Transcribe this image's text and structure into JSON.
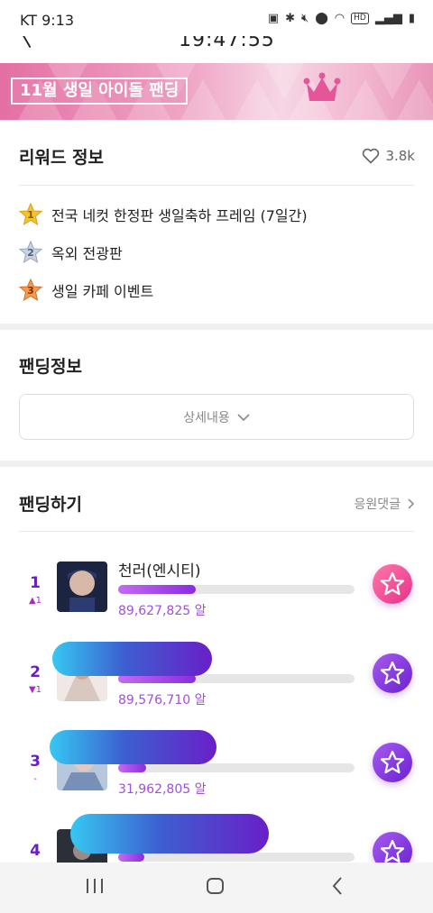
{
  "status_bar": {
    "carrier_time": "KT 9:13",
    "hd_label": "HD"
  },
  "top_bar": {
    "time": "19:47:55"
  },
  "banner": {
    "title": "11월 생일 아이돌 팬딩"
  },
  "reward": {
    "heading": "리워드 정보",
    "likes": "3.8k",
    "items": [
      {
        "rank": "1",
        "label": "전국 네컷 한정판 생일축하 프레임 (7일간)",
        "color": "#f2c230"
      },
      {
        "rank": "2",
        "label": "옥외 전광판",
        "color": "#b8c4d6"
      },
      {
        "rank": "3",
        "label": "생일 카페 이벤트",
        "color": "#f08a3c"
      }
    ]
  },
  "funding_info": {
    "heading": "팬딩정보",
    "detail_button": "상세내용"
  },
  "funding": {
    "heading": "팬딩하기",
    "cheer_link": "응원댓글",
    "entries": [
      {
        "rank": "1",
        "change": "▲1",
        "name": "천러(엔시티)",
        "amount": "89,627,825 알",
        "progress": 0.33
      },
      {
        "rank": "2",
        "change": "▼1",
        "name": "",
        "amount": "89,576,710 알",
        "progress": 0.33
      },
      {
        "rank": "3",
        "change": "-",
        "name": "",
        "amount": "31,962,805 알",
        "progress": 0.12
      },
      {
        "rank": "4",
        "change": "",
        "name": "",
        "amount": "",
        "progress": 0.11
      }
    ]
  },
  "colors": {
    "accent": "#6a1fc0",
    "vote_pink": "#f0508a",
    "vote_purple": "#8a3fe0"
  }
}
